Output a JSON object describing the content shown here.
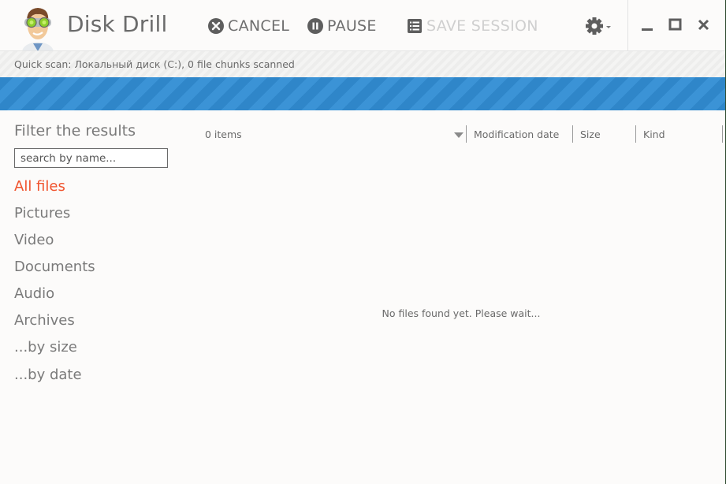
{
  "app": {
    "title": "Disk Drill"
  },
  "toolbar": {
    "cancel_label": "CANCEL",
    "pause_label": "PAUSE",
    "save_session_label": "SAVE SESSION",
    "save_session_enabled": false,
    "cancel_icon": "close-circle-icon",
    "pause_icon": "pause-circle-icon",
    "save_icon": "list-icon",
    "settings_icon": "gear-icon"
  },
  "window_controls": {
    "minimize": "minimize-icon",
    "maximize": "maximize-icon",
    "close": "close-icon"
  },
  "status": {
    "text": "Quick scan: Локальный диск (C:), 0 file chunks scanned"
  },
  "colors": {
    "accent": "#f0522c",
    "progress": "#2f86c9",
    "text": "#6a6a6a"
  },
  "sidebar": {
    "title": "Filter the results",
    "search_placeholder": "search by name...",
    "search_value": "",
    "categories": [
      {
        "label": "All files",
        "active": true
      },
      {
        "label": "Pictures",
        "active": false
      },
      {
        "label": "Video",
        "active": false
      },
      {
        "label": "Documents",
        "active": false
      },
      {
        "label": "Audio",
        "active": false
      },
      {
        "label": "Archives",
        "active": false
      },
      {
        "label": "...by size",
        "active": false
      },
      {
        "label": "...by date",
        "active": false
      }
    ]
  },
  "results": {
    "count_label": "0 items",
    "columns": [
      "Modification date",
      "Size",
      "Kind"
    ],
    "empty_message": "No files found yet. Please wait..."
  }
}
